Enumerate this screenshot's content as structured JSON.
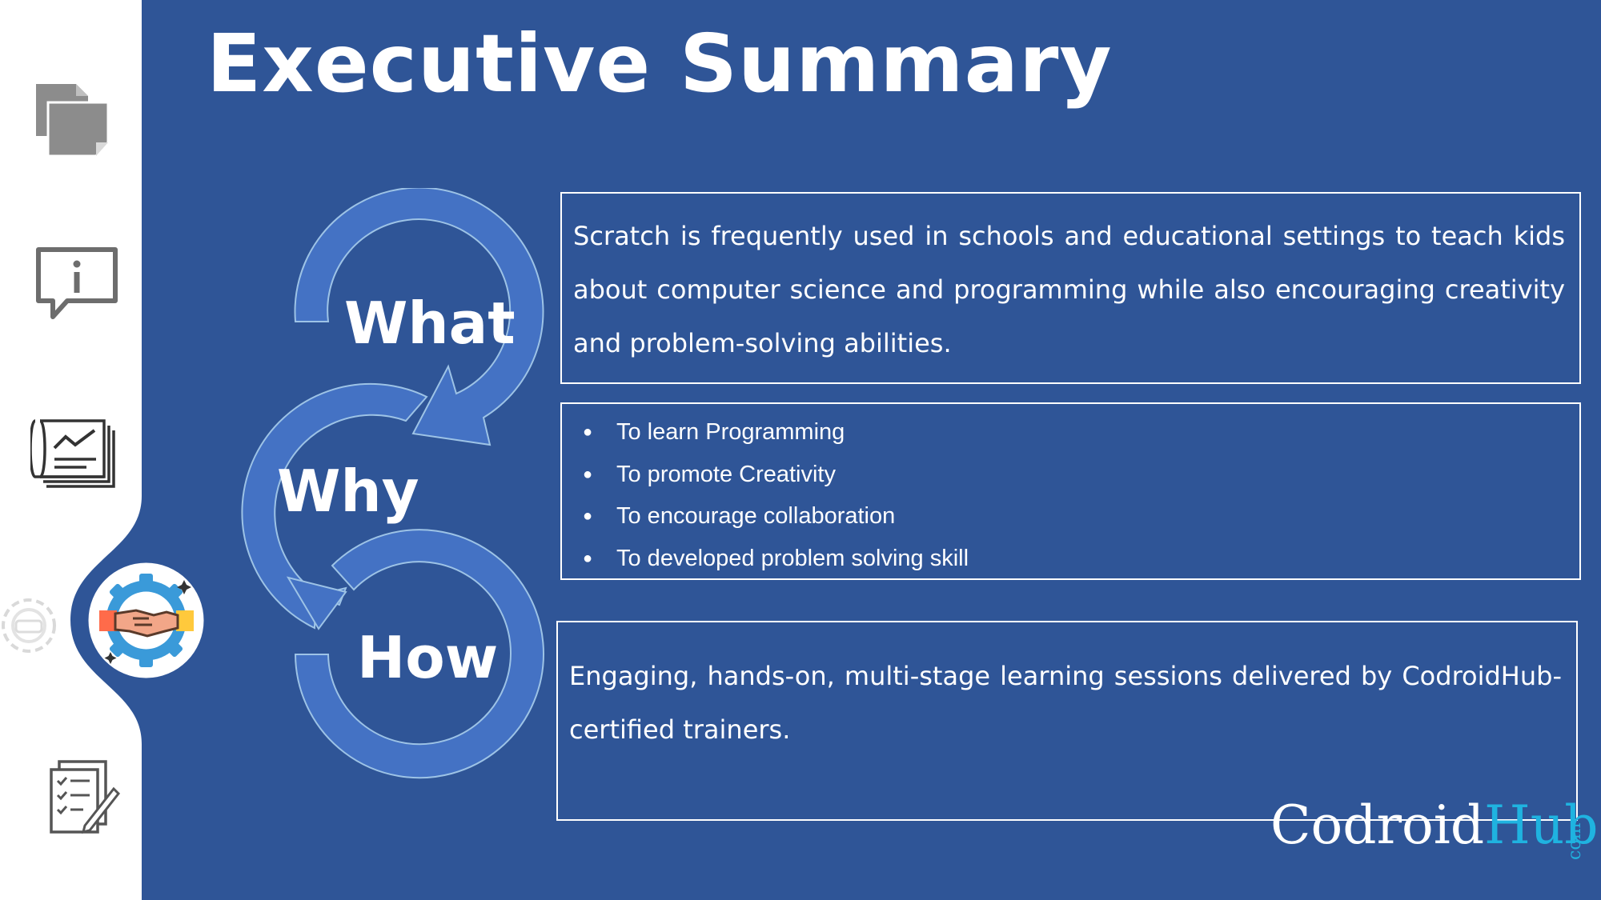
{
  "slide": {
    "title": "Executive Summary",
    "colors": {
      "background": "#2f5597",
      "sidebar": "#ffffff",
      "ring": "#4472c4",
      "accent": "#1fb3e0"
    }
  },
  "sidebar": {
    "items": [
      {
        "icon": "documents-icon"
      },
      {
        "icon": "info-chat-icon"
      },
      {
        "icon": "report-chart-icon"
      },
      {
        "icon": "handshake-gear-icon",
        "active": true
      },
      {
        "icon": "checklist-pen-icon"
      }
    ]
  },
  "cycle": {
    "labels": [
      "What",
      "Why",
      "How"
    ]
  },
  "what": {
    "text": "Scratch is frequently used in schools and educational settings to teach kids about computer science and programming while also encouraging creativity and problem-solving abilities."
  },
  "why": {
    "bullets": [
      "To learn Programming",
      "To promote Creativity",
      "To encourage collaboration",
      "To developed problem solving skill"
    ]
  },
  "how": {
    "text": "Engaging, hands-on, multi-stage learning sessions delivered by CodroidHub-certified trainers."
  },
  "brand": {
    "part1": "Codroid",
    "part2": "Hub",
    "dot": ".",
    "suffix": "com"
  }
}
